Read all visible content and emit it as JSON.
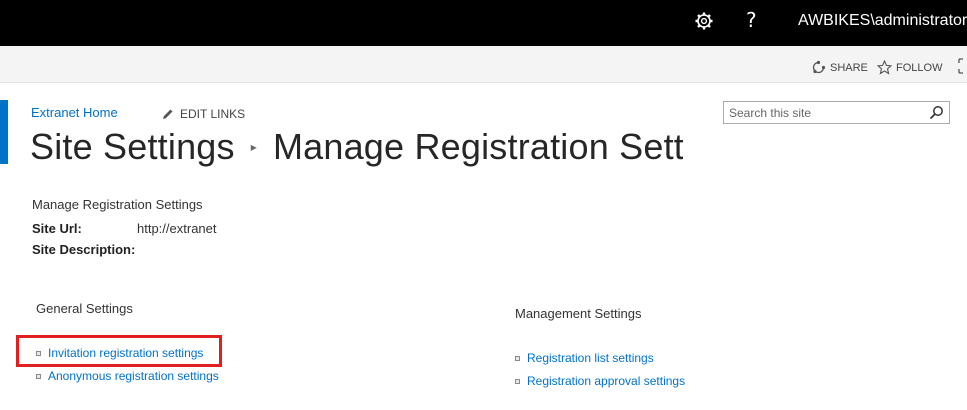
{
  "suitebar": {
    "user": "AWBIKES\\administrator",
    "help_glyph": "?",
    "settings_icon": "gear-icon"
  },
  "ribbon": {
    "share_label": "SHARE",
    "follow_label": "FOLLOW"
  },
  "nav": {
    "home_link": "Extranet Home",
    "edit_links": "EDIT LINKS"
  },
  "search": {
    "placeholder": "Search this site"
  },
  "page": {
    "breadcrumb_root": "Site Settings",
    "breadcrumb_sep": "▸",
    "title": "Manage Registration Settings"
  },
  "summary": {
    "heading": "Manage Registration Settings",
    "site_url_label": "Site Url:",
    "site_url_value": "http://extranet",
    "site_description_label": "Site Description:"
  },
  "general": {
    "heading": "General Settings",
    "links": [
      "Invitation registration settings",
      "Anonymous registration settings"
    ]
  },
  "management": {
    "heading": "Management Settings",
    "links": [
      "Registration list settings",
      "Registration approval settings"
    ]
  },
  "colors": {
    "accent": "#0072c6",
    "highlight": "#e02020"
  }
}
